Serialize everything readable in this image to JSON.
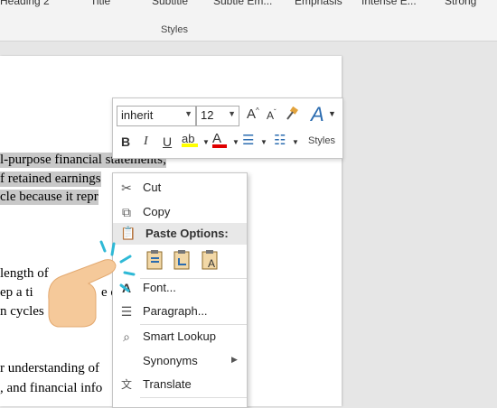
{
  "ribbon": {
    "styles": [
      "Heading 2",
      "Title",
      "Subtitle",
      "Subtle Em...",
      "Emphasis",
      "Intense E...",
      "Strong"
    ],
    "group_label": "Styles"
  },
  "document": {
    "lines": [
      "l-purpose financial statements;",
      "f retained earnings",
      "cle because it repr",
      "length of",
      "ep a ti",
      "e o",
      "n cycles",
      "r understanding of",
      ", and financial info"
    ]
  },
  "mini_toolbar": {
    "font_name": "inherit",
    "font_size": "12",
    "bold": "B",
    "italic": "I",
    "underline": "U",
    "styles_label": "Styles"
  },
  "context_menu": {
    "cut": "Cut",
    "copy": "Copy",
    "paste_options": "Paste Options:",
    "font": "Font...",
    "paragraph": "Paragraph...",
    "smart_lookup": "Smart Lookup",
    "synonyms": "Synonyms",
    "translate": "Translate"
  },
  "colors": {
    "highlight": "#ffff00",
    "font_color": "#e00000",
    "selection": "#c8c8c8",
    "pointer_accent": "#2fb9d6",
    "hand": "#f5c99a"
  }
}
